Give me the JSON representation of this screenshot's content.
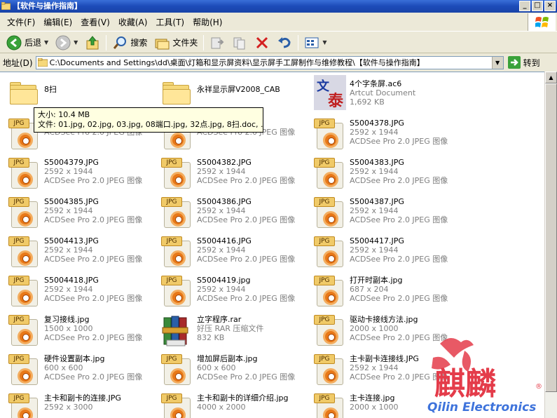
{
  "window": {
    "title": "【软件与操作指南】"
  },
  "menubar": {
    "items": [
      "文件(F)",
      "编辑(E)",
      "查看(V)",
      "收藏(A)",
      "工具(T)",
      "帮助(H)"
    ]
  },
  "toolbar": {
    "back_label": "后退",
    "search_label": "搜索",
    "folders_label": "文件夹"
  },
  "address": {
    "label": "地址(D)",
    "path": "C:\\Documents and Settings\\dd\\桌面\\灯箱和显示屏资料\\显示屏手工屏制作与维修教程\\【软件与操作指南】",
    "go_label": "转到"
  },
  "tooltip": {
    "line1": "大小: 10.4 MB",
    "line2": "文件: 01.jpg, 02.jpg, 03.jpg, 08端口.jpg, 32点.jpg, 8扫.doc, ..."
  },
  "files": [
    {
      "name": "8扫",
      "line2": "",
      "line3": "",
      "icon": "folder"
    },
    {
      "name": "永祥显示屏V2008_CAB",
      "line2": "",
      "line3": "",
      "icon": "folder"
    },
    {
      "name": "4个字条屏.ac6",
      "line2": "Artcut Document",
      "line3": "1,692 KB",
      "icon": "artcut"
    },
    {
      "name": "",
      "line2": "2592 x 1944",
      "line3": "ACDSee Pro 2.0 JPEG 图像",
      "icon": "jpg"
    },
    {
      "name": "",
      "line2": "2592 x 1944",
      "line3": "ACDSee Pro 2.0 JPEG 图像",
      "icon": "jpg"
    },
    {
      "name": "S5004378.JPG",
      "line2": "2592 x 1944",
      "line3": "ACDSee Pro 2.0 JPEG 图像",
      "icon": "jpg"
    },
    {
      "name": "S5004379.JPG",
      "line2": "2592 x 1944",
      "line3": "ACDSee Pro 2.0 JPEG 图像",
      "icon": "jpg"
    },
    {
      "name": "S5004382.JPG",
      "line2": "2592 x 1944",
      "line3": "ACDSee Pro 2.0 JPEG 图像",
      "icon": "jpg"
    },
    {
      "name": "S5004383.JPG",
      "line2": "2592 x 1944",
      "line3": "ACDSee Pro 2.0 JPEG 图像",
      "icon": "jpg"
    },
    {
      "name": "S5004385.JPG",
      "line2": "2592 x 1944",
      "line3": "ACDSee Pro 2.0 JPEG 图像",
      "icon": "jpg"
    },
    {
      "name": "S5004386.JPG",
      "line2": "2592 x 1944",
      "line3": "ACDSee Pro 2.0 JPEG 图像",
      "icon": "jpg"
    },
    {
      "name": "S5004387.JPG",
      "line2": "2592 x 1944",
      "line3": "ACDSee Pro 2.0 JPEG 图像",
      "icon": "jpg"
    },
    {
      "name": "S5004413.JPG",
      "line2": "2592 x 1944",
      "line3": "ACDSee Pro 2.0 JPEG 图像",
      "icon": "jpg"
    },
    {
      "name": "S5004416.JPG",
      "line2": "2592 x 1944",
      "line3": "ACDSee Pro 2.0 JPEG 图像",
      "icon": "jpg"
    },
    {
      "name": "S5004417.JPG",
      "line2": "2592 x 1944",
      "line3": "ACDSee Pro 2.0 JPEG 图像",
      "icon": "jpg"
    },
    {
      "name": "S5004418.JPG",
      "line2": "2592 x 1944",
      "line3": "ACDSee Pro 2.0 JPEG 图像",
      "icon": "jpg"
    },
    {
      "name": "S5004419.jpg",
      "line2": "2592 x 1944",
      "line3": "ACDSee Pro 2.0 JPEG 图像",
      "icon": "jpg"
    },
    {
      "name": "打开时副本.jpg",
      "line2": "687 x 204",
      "line3": "ACDSee Pro 2.0 JPEG 图像",
      "icon": "jpg"
    },
    {
      "name": "复习接线.jpg",
      "line2": "1500 x 1000",
      "line3": "ACDSee Pro 2.0 JPEG 图像",
      "icon": "jpg"
    },
    {
      "name": "立字程序.rar",
      "line2": "好压 RAR 压缩文件",
      "line3": "832 KB",
      "icon": "rar"
    },
    {
      "name": "驱动卡接线方法.jpg",
      "line2": "2000 x 1000",
      "line3": "ACDSee Pro 2.0 JPEG 图像",
      "icon": "jpg"
    },
    {
      "name": "硬件设置副本.jpg",
      "line2": "600 x 600",
      "line3": "ACDSee Pro 2.0 JPEG 图像",
      "icon": "jpg"
    },
    {
      "name": "增加屏后副本.jpg",
      "line2": "600 x 600",
      "line3": "ACDSee Pro 2.0 JPEG 图像",
      "icon": "jpg"
    },
    {
      "name": "主卡副卡连接线.JPG",
      "line2": "2592 x 1944",
      "line3": "ACDSee Pro 2.0 JPEG 图像",
      "icon": "jpg"
    },
    {
      "name": "主卡和副卡的连接.JPG",
      "line2": "2592 x 3000",
      "line3": "",
      "icon": "jpg"
    },
    {
      "name": "主卡和副卡的详细介绍.jpg",
      "line2": "4000 x 2000",
      "line3": "",
      "icon": "jpg"
    },
    {
      "name": "主卡连接.jpg",
      "line2": "2000 x 1000",
      "line3": "",
      "icon": "jpg"
    }
  ],
  "watermark": {
    "text": "麒麟",
    "brand": "Qilin Electronics",
    "mark": "®"
  }
}
